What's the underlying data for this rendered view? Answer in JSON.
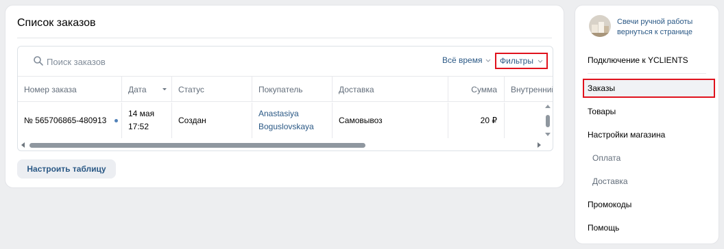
{
  "main": {
    "title": "Список заказов",
    "search_placeholder": "Поиск заказов",
    "time_filter": "Всё время",
    "filters": "Фильтры",
    "config_button": "Настроить таблицу"
  },
  "table": {
    "columns": [
      "Номер заказа",
      "Дата",
      "Статус",
      "Покупатель",
      "Доставка",
      "Сумма",
      "Внутренний"
    ],
    "rows": [
      {
        "order_number": "№ 565706865-480913",
        "date_line1": "14 мая",
        "date_line2": "17:52",
        "status": "Создан",
        "buyer_line1": "Anastasiya",
        "buyer_line2": "Boguslovskaya",
        "delivery": "Самовывоз",
        "sum": "20 ₽"
      }
    ]
  },
  "sidebar": {
    "shop_name": "Свечи ручной работы",
    "back_link": "вернуться к странице",
    "items": [
      "Подключение к YCLIENTS",
      "Заказы",
      "Товары",
      "Настройки магазина",
      "Оплата",
      "Доставка",
      "Промокоды",
      "Помощь"
    ],
    "active_item": "Заказы"
  },
  "colors": {
    "link": "#2a5885",
    "highlight": "#e0111c",
    "background": "#edeef0"
  }
}
